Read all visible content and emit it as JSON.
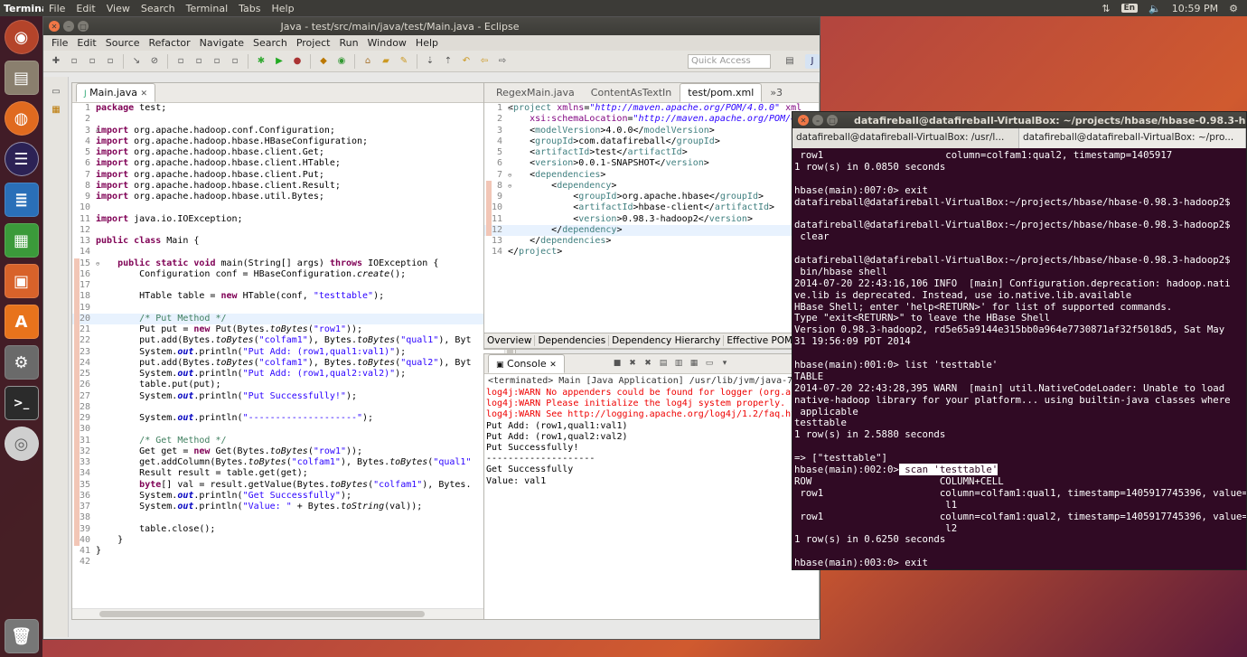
{
  "top_panel": {
    "app_name": "Terminal",
    "menus": [
      "File",
      "Edit",
      "View",
      "Search",
      "Terminal",
      "Tabs",
      "Help"
    ],
    "lang": "En",
    "clock": "10:59 PM"
  },
  "launcher": {
    "items": [
      "ubuntu-dash-icon",
      "files-icon",
      "firefox-icon",
      "eclipse-icon",
      "writer-icon",
      "calc-icon",
      "impress-icon",
      "software-center-icon",
      "settings-icon",
      "terminal-icon",
      "dvd-icon",
      "trash-icon"
    ]
  },
  "eclipse": {
    "title": "Java - test/src/main/java/test/Main.java - Eclipse",
    "menu": [
      "File",
      "Edit",
      "Source",
      "Refactor",
      "Navigate",
      "Search",
      "Project",
      "Run",
      "Window",
      "Help"
    ],
    "quick_access_placeholder": "Quick Access",
    "editor_tab": "Main.java",
    "editor_lines": [
      {
        "n": "1",
        "html": "<span class='kw'>package</span> test;"
      },
      {
        "n": "2",
        "html": ""
      },
      {
        "n": "3",
        "fold": "⊖",
        "html": "<span class='kw'>import</span> org.apache.hadoop.conf.Configuration;"
      },
      {
        "n": "4",
        "html": "<span class='kw'>import</span> org.apache.hadoop.hbase.HBaseConfiguration;"
      },
      {
        "n": "5",
        "html": "<span class='kw'>import</span> org.apache.hadoop.hbase.client.Get;"
      },
      {
        "n": "6",
        "html": "<span class='kw'>import</span> org.apache.hadoop.hbase.client.HTable;"
      },
      {
        "n": "7",
        "html": "<span class='kw'>import</span> org.apache.hadoop.hbase.client.Put;"
      },
      {
        "n": "8",
        "html": "<span class='kw'>import</span> org.apache.hadoop.hbase.client.Result;"
      },
      {
        "n": "9",
        "html": "<span class='kw'>import</span> org.apache.hadoop.hbase.util.Bytes;"
      },
      {
        "n": "10",
        "html": ""
      },
      {
        "n": "11",
        "html": "<span class='kw'>import</span> java.io.IOException;"
      },
      {
        "n": "12",
        "html": ""
      },
      {
        "n": "13",
        "html": "<span class='kw'>public</span> <span class='kw'>class</span> Main {"
      },
      {
        "n": "14",
        "html": ""
      },
      {
        "n": "15",
        "fold": "⊖",
        "mark": true,
        "html": "    <span class='kw'>public</span> <span class='kw'>static</span> <span class='kw'>void</span> main(String[] args) <span class='kw'>throws</span> IOException {"
      },
      {
        "n": "16",
        "mark": true,
        "html": "        Configuration conf = HBaseConfiguration.<span class='ital'>create</span>();"
      },
      {
        "n": "17",
        "mark": true,
        "html": ""
      },
      {
        "n": "18",
        "mark": true,
        "html": "        HTable table = <span class='kw'>new</span> HTable(conf, <span class='str'>\"testtable\"</span>);"
      },
      {
        "n": "19",
        "mark": true,
        "html": ""
      },
      {
        "n": "20",
        "mark": true,
        "hl": true,
        "html": "        <span class='com'>/* Put Method */</span>"
      },
      {
        "n": "21",
        "mark": true,
        "html": "        Put put = <span class='kw'>new</span> Put(Bytes.<span class='ital'>toBytes</span>(<span class='str'>\"row1\"</span>));"
      },
      {
        "n": "22",
        "mark": true,
        "html": "        put.add(Bytes.<span class='ital'>toBytes</span>(<span class='str'>\"colfam1\"</span>), Bytes.<span class='ital'>toBytes</span>(<span class='str'>\"qual1\"</span>), Byt"
      },
      {
        "n": "23",
        "mark": true,
        "html": "        System.<span class='fld'>out</span>.println(<span class='str'>\"Put Add: (row1,qual1:val1)\"</span>);"
      },
      {
        "n": "24",
        "mark": true,
        "html": "        put.add(Bytes.<span class='ital'>toBytes</span>(<span class='str'>\"colfam1\"</span>), Bytes.<span class='ital'>toBytes</span>(<span class='str'>\"qual2\"</span>), Byt"
      },
      {
        "n": "25",
        "mark": true,
        "html": "        System.<span class='fld'>out</span>.println(<span class='str'>\"Put Add: (row1,qual2:val2)\"</span>);"
      },
      {
        "n": "26",
        "mark": true,
        "html": "        table.put(put);"
      },
      {
        "n": "27",
        "mark": true,
        "html": "        System.<span class='fld'>out</span>.println(<span class='str'>\"Put Successfully!\"</span>);"
      },
      {
        "n": "28",
        "mark": true,
        "html": ""
      },
      {
        "n": "29",
        "mark": true,
        "html": "        System.<span class='fld'>out</span>.println(<span class='str'>\"--------------------\"</span>);"
      },
      {
        "n": "30",
        "mark": true,
        "html": ""
      },
      {
        "n": "31",
        "mark": true,
        "html": "        <span class='com'>/* Get Method */</span>"
      },
      {
        "n": "32",
        "mark": true,
        "html": "        Get get = <span class='kw'>new</span> Get(Bytes.<span class='ital'>toBytes</span>(<span class='str'>\"row1\"</span>));"
      },
      {
        "n": "33",
        "mark": true,
        "html": "        get.addColumn(Bytes.<span class='ital'>toBytes</span>(<span class='str'>\"colfam1\"</span>), Bytes.<span class='ital'>toBytes</span>(<span class='str'>\"qual1\"</span>"
      },
      {
        "n": "34",
        "mark": true,
        "html": "        Result result = table.get(get);"
      },
      {
        "n": "35",
        "mark": true,
        "html": "        <span class='kw'>byte</span>[] val = result.getValue(Bytes.<span class='ital'>toBytes</span>(<span class='str'>\"colfam1\"</span>), Bytes."
      },
      {
        "n": "36",
        "mark": true,
        "html": "        System.<span class='fld'>out</span>.println(<span class='str'>\"Get Successfully\"</span>);"
      },
      {
        "n": "37",
        "mark": true,
        "html": "        System.<span class='fld'>out</span>.println(<span class='str'>\"Value: \"</span> + Bytes.<span class='ital'>toString</span>(val));"
      },
      {
        "n": "38",
        "mark": true,
        "html": ""
      },
      {
        "n": "39",
        "mark": true,
        "html": "        table.close();"
      },
      {
        "n": "40",
        "mark": true,
        "html": "    }"
      },
      {
        "n": "41",
        "html": "}"
      },
      {
        "n": "42",
        "html": ""
      }
    ],
    "xml_tabs": [
      "RegexMain.java",
      "ContentAsTextIn",
      "test/pom.xml",
      "»3"
    ],
    "xml_lines": [
      {
        "n": "1",
        "fold": "⊖",
        "html": "&lt;<span class='xtag'>project</span> <span class='xattr'>xmlns</span>=<span class='xval'>\"http://maven.apache.org/POM/4.0.0\"</span> <span class='xattr'>xml</span>"
      },
      {
        "n": "2",
        "html": "    <span class='xattr'>xsi:schemaLocation</span>=<span class='xval'>\"http://maven.apache.org/POM/4.0</span>"
      },
      {
        "n": "3",
        "html": "    &lt;<span class='xtag'>modelVersion</span>&gt;4.0.0&lt;/<span class='xtag'>modelVersion</span>&gt;"
      },
      {
        "n": "4",
        "html": "    &lt;<span class='xtag'>groupId</span>&gt;com.datafireball&lt;/<span class='xtag'>groupId</span>&gt;"
      },
      {
        "n": "5",
        "html": "    &lt;<span class='xtag'>artifactId</span>&gt;test&lt;/<span class='xtag'>artifactId</span>&gt;"
      },
      {
        "n": "6",
        "html": "    &lt;<span class='xtag'>version</span>&gt;0.0.1-SNAPSHOT&lt;/<span class='xtag'>version</span>&gt;"
      },
      {
        "n": "7",
        "fold": "⊖",
        "html": "    &lt;<span class='xtag'>dependencies</span>&gt;"
      },
      {
        "n": "8",
        "fold": "⊖",
        "mark": true,
        "html": "        &lt;<span class='xtag'>dependency</span>&gt;"
      },
      {
        "n": "9",
        "mark": true,
        "html": "            &lt;<span class='xtag'>groupId</span>&gt;org.apache.hbase&lt;/<span class='xtag'>groupId</span>&gt;"
      },
      {
        "n": "10",
        "mark": true,
        "html": "            &lt;<span class='xtag'>artifactId</span>&gt;hbase-client&lt;/<span class='xtag'>artifactId</span>&gt;"
      },
      {
        "n": "11",
        "mark": true,
        "html": "            &lt;<span class='xtag'>version</span>&gt;0.98.3-hadoop2&lt;/<span class='xtag'>version</span>&gt;"
      },
      {
        "n": "12",
        "mark": true,
        "hl": true,
        "html": "        &lt;/<span class='xtag'>dependency</span>&gt;"
      },
      {
        "n": "13",
        "html": "    &lt;/<span class='xtag'>dependencies</span>&gt;"
      },
      {
        "n": "14",
        "html": "&lt;/<span class='xtag'>project</span>&gt;"
      }
    ],
    "pom_tabs": [
      "Overview",
      "Dependencies",
      "Dependency Hierarchy",
      "Effective POM",
      "pom.x"
    ],
    "console_tab": "Console",
    "console_status": "<terminated> Main [Java Application] /usr/lib/jvm/java-7-openjdk-amd",
    "console_lines": [
      {
        "t": "log4j:WARN No appenders could be found for logger (org.apac",
        "err": true
      },
      {
        "t": "log4j:WARN Please initialize the log4j system properly.",
        "err": true
      },
      {
        "t": "log4j:WARN See http://logging.apache.org/log4j/1.2/faq.html",
        "err": true
      },
      {
        "t": "Put Add: (row1,qual1:val1)"
      },
      {
        "t": "Put Add: (row1,qual2:val2)"
      },
      {
        "t": "Put Successfully!"
      },
      {
        "t": "--------------------"
      },
      {
        "t": "Get Successfully"
      },
      {
        "t": "Value: val1"
      }
    ]
  },
  "terminal": {
    "title": "datafireball@datafireball-VirtualBox: ~/projects/hbase/hbase-0.98.3-hadoop2",
    "tabs": [
      "datafireball@datafireball-VirtualBox: /usr/l...",
      "datafireball@datafireball-VirtualBox: ~/pro..."
    ],
    "lines": [
      " row1                     column=colfam1:qual2, timestamp=1405917",
      "1 row(s) in 0.0850 seconds",
      "",
      "hbase(main):007:0> exit",
      "datafireball@datafireball-VirtualBox:~/projects/hbase/hbase-0.98.3-hadoop2$",
      "",
      "datafireball@datafireball-VirtualBox:~/projects/hbase/hbase-0.98.3-hadoop2$",
      " clear",
      "",
      "datafireball@datafireball-VirtualBox:~/projects/hbase/hbase-0.98.3-hadoop2$",
      " bin/hbase shell",
      "2014-07-20 22:43:16,106 INFO  [main] Configuration.deprecation: hadoop.nati",
      "ve.lib is deprecated. Instead, use io.native.lib.available",
      "HBase Shell; enter 'help<RETURN>' for list of supported commands.",
      "Type \"exit<RETURN>\" to leave the HBase Shell",
      "Version 0.98.3-hadoop2, rd5e65a9144e315bb0a964e7730871af32f5018d5, Sat May",
      "31 19:56:09 PDT 2014",
      "",
      "hbase(main):001:0> list 'testtable'",
      "TABLE",
      "2014-07-20 22:43:28,395 WARN  [main] util.NativeCodeLoader: Unable to load",
      "native-hadoop library for your platform... using builtin-java classes where",
      " applicable",
      "testtable",
      "1 row(s) in 2.5880 seconds",
      "",
      "=> [\"testtable\"]",
      "hbase(main):002:0>",
      "ROW                      COLUMN+CELL",
      " row1                    column=colfam1:qual1, timestamp=1405917745396, value=va",
      "                          l1",
      " row1                    column=colfam1:qual2, timestamp=1405917745396, value=va",
      "                          l2",
      "1 row(s) in 0.6250 seconds",
      "",
      "hbase(main):003:0> exit"
    ],
    "selected_command": " scan 'testtable'"
  }
}
